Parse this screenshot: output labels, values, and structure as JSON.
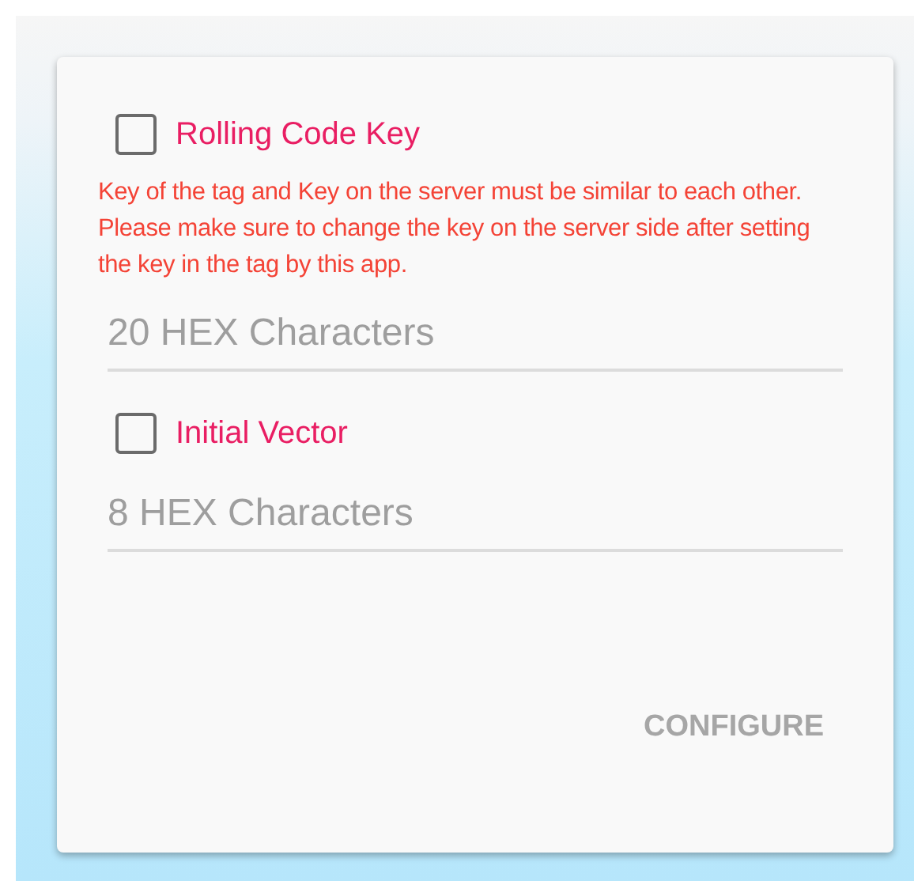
{
  "options": [
    {
      "checkbox": {
        "label": "Rolling Code Key",
        "checked": false
      },
      "note": "Key of the tag and Key on the server must be similar to each other. Please make sure to change the key on the server side after setting the key in the tag by this app.",
      "field": {
        "placeholder": "20 HEX Characters"
      }
    },
    {
      "checkbox": {
        "label": "Initial Vector",
        "checked": false
      },
      "field": {
        "placeholder": "8 HEX Characters"
      }
    }
  ],
  "button": {
    "label": "CONFIGURE",
    "disabled": true
  }
}
